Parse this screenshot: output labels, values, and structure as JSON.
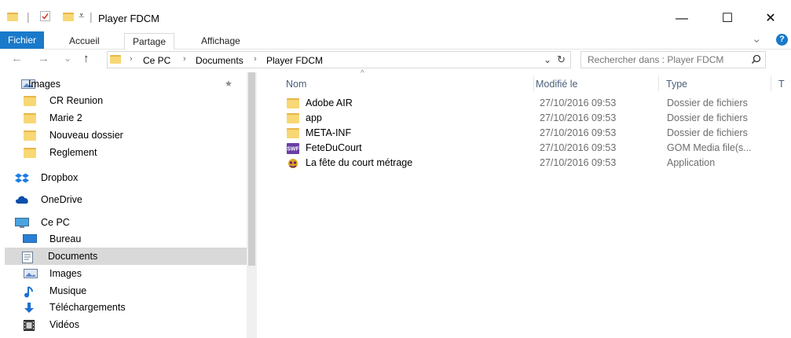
{
  "window": {
    "title": "Player FDCM",
    "minimize": "—",
    "maximize": "☐",
    "close": "✕"
  },
  "ribbon": {
    "tabs": [
      "Fichier",
      "Accueil",
      "Partage",
      "Affichage"
    ],
    "help": "?",
    "expand": "⌄"
  },
  "address": {
    "crumbs": [
      "Ce PC",
      "Documents",
      "Player FDCM"
    ],
    "back": "←",
    "forward": "→",
    "recent": "⌄",
    "up": "↑",
    "dropdown": "⌄",
    "refresh": "↻"
  },
  "search": {
    "placeholder": "Rechercher dans : Player FDCM",
    "icon": "search-icon"
  },
  "nav": {
    "items": [
      {
        "label": "Images",
        "icon": "pictures-icon",
        "pinned": true
      },
      {
        "label": "CR Reunion",
        "icon": "folder-icon"
      },
      {
        "label": "Marie 2",
        "icon": "folder-icon"
      },
      {
        "label": "Nouveau dossier",
        "icon": "folder-icon"
      },
      {
        "label": "Reglement",
        "icon": "folder-icon"
      },
      {
        "label": "Dropbox",
        "icon": "dropbox-icon"
      },
      {
        "label": "OneDrive",
        "icon": "onedrive-icon"
      },
      {
        "label": "Ce PC",
        "icon": "computer-icon"
      },
      {
        "label": "Bureau",
        "icon": "desktop-icon"
      },
      {
        "label": "Documents",
        "icon": "documents-icon",
        "selected": true
      },
      {
        "label": "Images",
        "icon": "pictures-icon"
      },
      {
        "label": "Musique",
        "icon": "music-icon"
      },
      {
        "label": "Téléchargements",
        "icon": "downloads-icon"
      },
      {
        "label": "Vidéos",
        "icon": "videos-icon"
      }
    ]
  },
  "columns": [
    "Nom",
    "Modifié le",
    "Type",
    "T"
  ],
  "files": [
    {
      "name": "Adobe AIR",
      "date": "27/10/2016 09:53",
      "type": "Dossier de fichiers",
      "icon": "folder-icon"
    },
    {
      "name": "app",
      "date": "27/10/2016 09:53",
      "type": "Dossier de fichiers",
      "icon": "folder-icon"
    },
    {
      "name": "META-INF",
      "date": "27/10/2016 09:53",
      "type": "Dossier de fichiers",
      "icon": "folder-icon"
    },
    {
      "name": "FeteDuCourt",
      "date": "27/10/2016 09:53",
      "type": "GOM Media file(s...",
      "icon": "swf-file-icon"
    },
    {
      "name": "La fête du court métrage",
      "date": "27/10/2016 09:53",
      "type": "Application",
      "icon": "application-icon"
    }
  ],
  "colors": {
    "accent": "#1979ca",
    "selection": "#d9d9d9",
    "folder": "#f8d775",
    "header_text": "#4c607a"
  }
}
